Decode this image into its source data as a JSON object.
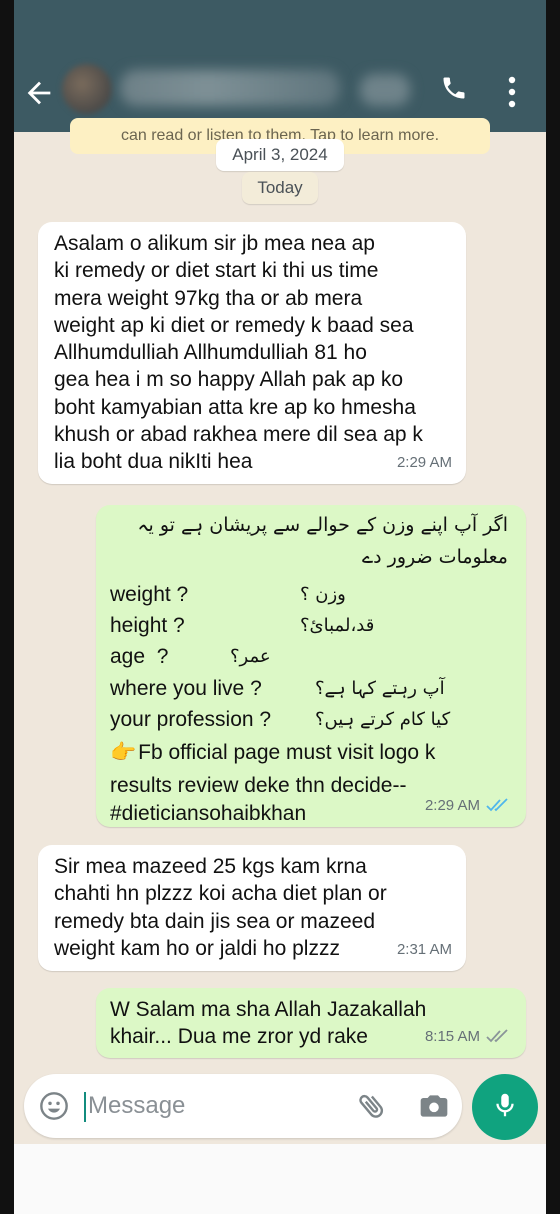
{
  "header": {
    "back_icon": "arrow-left-icon",
    "call_icon": "phone-icon",
    "menu_icon": "more-vert-icon"
  },
  "banner": {
    "text": "can read or listen to them. Tap to learn more."
  },
  "chips": {
    "date": "April 3, 2024",
    "today": "Today"
  },
  "messages": [
    {
      "direction": "in",
      "text": "Asalam o alikum sir jb mea nea ap\nki remedy or diet start ki thi us time\nmera weight 97kg tha or ab mera\nweight ap ki diet or remedy k baad sea\nAllhumdulliah Allhumdulliah 81 ho\ngea hea  i m so happy Allah pak ap ko\nboht kamyabian atta kre ap ko hmesha\nkhush or abad rakhea mere dil sea ap k\nlia boht dua nikIti hea",
      "time": "2:29 AM"
    },
    {
      "direction": "out",
      "urdu_line1": "اگر آپ اپنے وزن کے حوالے سے پریشان ہے تو یہ",
      "urdu_line2": "معلومات ضرور دے",
      "questions": [
        {
          "en": "weight ?",
          "ur": "وزن ؟"
        },
        {
          "en": "height ?",
          "ur": "قد،لمبائ؟"
        },
        {
          "en": "age  ?",
          "ur": "عمر؟"
        },
        {
          "en": "where you live ?",
          "ur": "آپ رہتے کہا ہے؟"
        },
        {
          "en": "your profession ?",
          "ur": "کیا کام کرتے ہیں؟"
        }
      ],
      "pointer": "👉",
      "line_fb": "Fb official page must visit logo k",
      "line_results": "results review deke thn decide--",
      "line_tag": "#dieticiansohaibkhan",
      "time": "2:29 AM",
      "status": "read",
      "tick_color": "#4fb6ec"
    },
    {
      "direction": "in",
      "text": "Sir mea mazeed 25 kgs kam krna\nchahti hn plzzz koi acha diet plan or\nremedy bta dain jis sea or mazeed\nweight kam ho or jaldi ho plzzz",
      "time": "2:31 AM"
    },
    {
      "direction": "out",
      "text": "W Salam ma sha Allah Jazakallah\nkhair... Dua me zror yd rake",
      "time": "8:15 AM",
      "status": "delivered",
      "tick_color": "#8a9499"
    }
  ],
  "composer": {
    "placeholder": "Message",
    "emoji_icon": "emoji-icon",
    "attach_icon": "paperclip-icon",
    "camera_icon": "camera-icon",
    "mic_icon": "mic-icon",
    "accent": "#10a37f"
  }
}
